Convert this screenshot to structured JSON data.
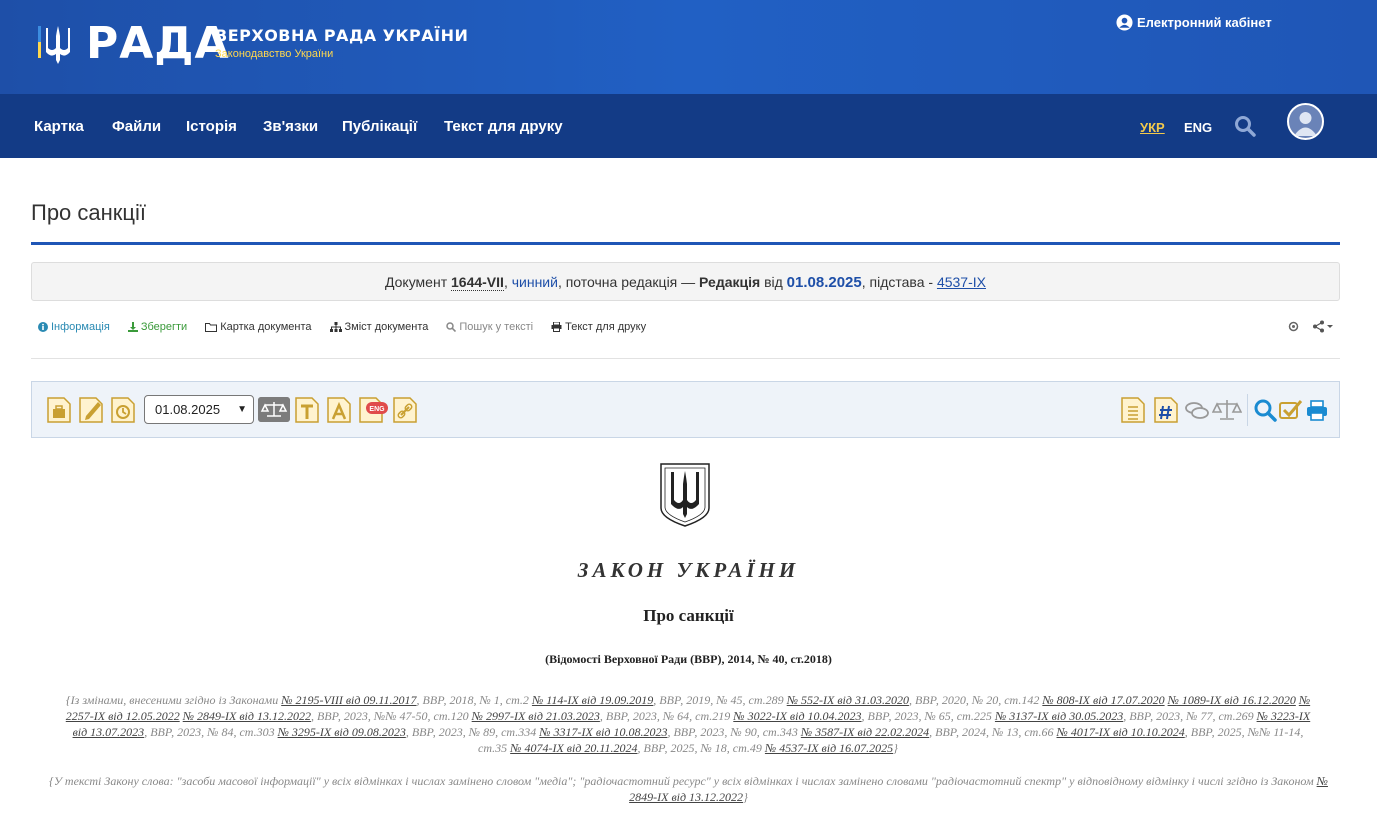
{
  "header": {
    "logo_text": "РАДА",
    "title": "ВЕРХОВНА РАДА УКРАЇНИ",
    "subtitle": "Законодавство України",
    "cabinet_label": "Електронний кабінет"
  },
  "nav": {
    "items": [
      "Картка",
      "Файли",
      "Історія",
      "Зв'язки",
      "Публікації",
      "Текст для друку"
    ],
    "lang_ukr": "УКР",
    "lang_eng": "ENG"
  },
  "page": {
    "title": "Про санкції"
  },
  "doc_bar": {
    "prefix": "Документ",
    "number": "1644-VII",
    "status": "чинний",
    "current": ", поточна редакція —",
    "edition_label": "Редакція",
    "from_label": "від",
    "date": "01.08.2025",
    "basis_label": ", підстава -",
    "basis": "4537-IX"
  },
  "small_toolbar": {
    "info": "Інформація",
    "save": "Зберегти",
    "card": "Картка документа",
    "contents": "Зміст документа",
    "search": "Пошук у тексті",
    "print": "Текст для друку"
  },
  "big_toolbar": {
    "date_value": "01.08.2025",
    "eng_badge": "ENG"
  },
  "document": {
    "head": "ЗАКОН УКРАЇНИ",
    "title": "Про санкції",
    "vvr": "(Відомості Верховної Ради (ВВР), 2014, № 40, ст.2018)",
    "amend_intro": "{Із змінами, внесеними згідно із Законами",
    "amendments": [
      {
        "link": "№ 2195-VIII від 09.11.2017",
        "ref": ", ВВР, 2018, № 1, ст.2"
      },
      {
        "link": "№ 114-IX від 19.09.2019",
        "ref": ", ВВР, 2019, № 45, ст.289"
      },
      {
        "link": "№ 552-IX від 31.03.2020",
        "ref": ", ВВР, 2020, № 20, ст.142"
      },
      {
        "link": "№ 808-IX від 17.07.2020",
        "ref": ""
      },
      {
        "link": "№ 1089-IX від 16.12.2020",
        "ref": ""
      },
      {
        "link": "№ 2257-IX від 12.05.2022",
        "ref": ""
      },
      {
        "link": "№ 2849-IX від 13.12.2022",
        "ref": ", ВВР, 2023, №№ 47-50, ст.120"
      },
      {
        "link": "№ 2997-IX від 21.03.2023",
        "ref": ", ВВР, 2023, № 64, ст.219"
      },
      {
        "link": "№ 3022-IX від 10.04.2023",
        "ref": ", ВВР, 2023, № 65, ст.225"
      },
      {
        "link": "№ 3137-IX від 30.05.2023",
        "ref": ", ВВР, 2023, № 77, ст.269"
      },
      {
        "link": "№ 3223-IX від 13.07.2023",
        "ref": ", ВВР, 2023, № 84, ст.303"
      },
      {
        "link": "№ 3295-IX від 09.08.2023",
        "ref": ", ВВР, 2023, № 89, ст.334"
      },
      {
        "link": "№ 3317-IX від 10.08.2023",
        "ref": ", ВВР, 2023, № 90, ст.343"
      },
      {
        "link": "№ 3587-IX від 22.02.2024",
        "ref": ", ВВР, 2024, № 13, ст.66"
      },
      {
        "link": "№ 4017-IX від 10.10.2024",
        "ref": ", ВВР, 2025, №№ 11-14, ст.35"
      },
      {
        "link": "№ 4074-IX від 20.11.2024",
        "ref": ", ВВР, 2025, № 18, ст.49"
      },
      {
        "link": "№ 4537-IX від 16.07.2025",
        "ref": "}"
      }
    ],
    "note_text": "{У тексті Закону слова: \"засоби масової інформації\" у всіх відмінках і числах замінено словом \"медіа\"; \"радіочастотний ресурс\" у всіх відмінках і числах замінено словами \"радіочастотний спектр\" у відповідному відмінку і числі згідно із Законом",
    "note_link": "№ 2849-IX від 13.12.2022",
    "note_end": "}"
  }
}
